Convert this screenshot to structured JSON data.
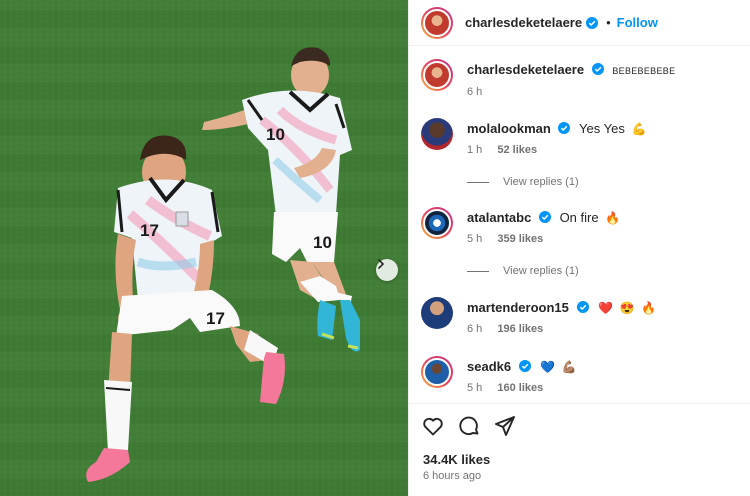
{
  "header": {
    "username": "charlesdeketelaere",
    "separator": "•",
    "follow_label": "Follow"
  },
  "caption": {
    "username": "charlesdeketelaere",
    "text": "BEBEBEBEBE",
    "time": "6 h"
  },
  "comments": [
    {
      "username": "molalookman",
      "text": "Yes Yes",
      "emojis": [
        "💪"
      ],
      "time": "1 h",
      "likes": "52 likes",
      "replies": "View replies (1)"
    },
    {
      "username": "atalantabc",
      "text": "On fire",
      "emojis": [
        "🔥"
      ],
      "time": "5 h",
      "likes": "359 likes",
      "replies": "View replies (1)"
    },
    {
      "username": "martenderoon15",
      "text": "",
      "emojis": [
        "❤️",
        "😍",
        "🔥"
      ],
      "time": "6 h",
      "likes": "196 likes"
    },
    {
      "username": "seadk6",
      "text": "",
      "emojis": [
        "💙",
        "💪🏽"
      ],
      "time": "5 h",
      "likes": "160 likes"
    }
  ],
  "post": {
    "likes": "34.4K likes",
    "time_ago": "6 hours ago"
  },
  "icons": {
    "like": "heart-icon",
    "comment": "comment-icon",
    "share": "share-icon",
    "next": "chevron-right-icon",
    "verified": "verified-badge-icon"
  },
  "colors": {
    "accent": "#0095f6",
    "text": "#262626",
    "muted": "#737373",
    "verified": "#0095f6"
  },
  "jersey_numbers": [
    "17",
    "10"
  ]
}
